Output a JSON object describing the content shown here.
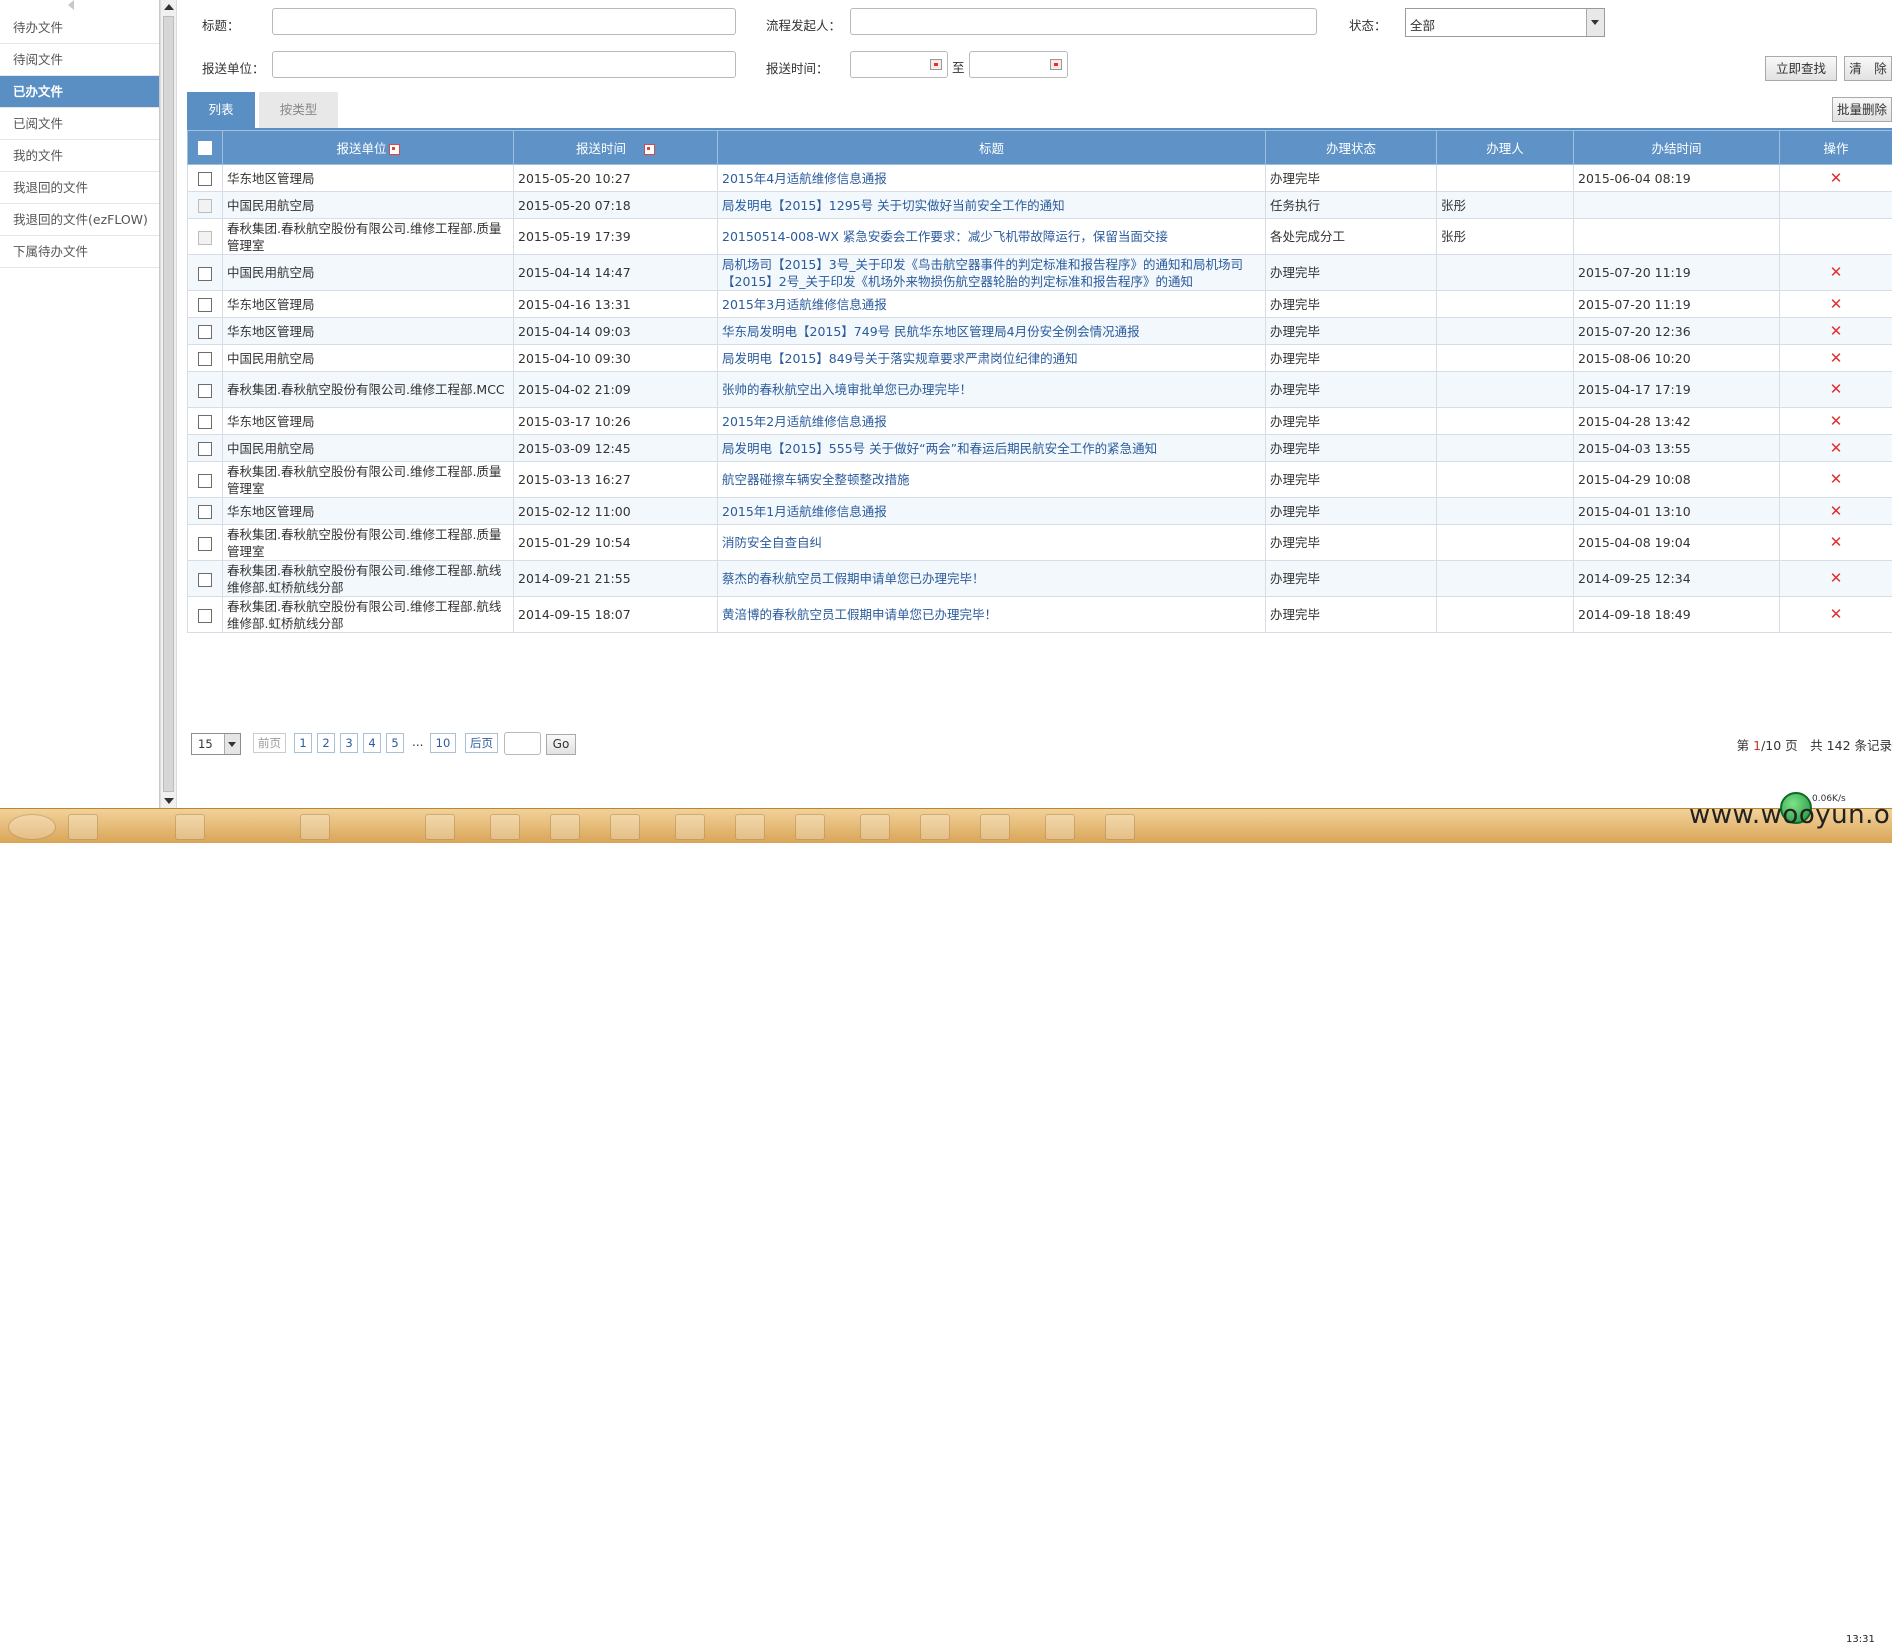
{
  "sidebar": {
    "items": [
      {
        "label": "待办文件",
        "active": false
      },
      {
        "label": "待阅文件",
        "active": false
      },
      {
        "label": "已办文件",
        "active": true
      },
      {
        "label": "已阅文件",
        "active": false
      },
      {
        "label": "我的文件",
        "active": false
      },
      {
        "label": "我退回的文件",
        "active": false
      },
      {
        "label": "我退回的文件(ezFLOW)",
        "active": false
      },
      {
        "label": "下属待办文件",
        "active": false
      }
    ]
  },
  "filters": {
    "title_label": "标题：",
    "title_value": "",
    "initiator_label": "流程发起人：",
    "initiator_value": "",
    "status_label": "状态：",
    "status_value": "全部",
    "unit_label": "报送单位：",
    "unit_value": "",
    "time_label": "报送时间：",
    "time_from": "",
    "time_to_label": "至",
    "time_to": "",
    "search_button": "立即查找",
    "clear_button": "清　除"
  },
  "tabs": {
    "list": "列表",
    "by_type": "按类型"
  },
  "batch_delete": "批量删除",
  "table": {
    "headers": {
      "unit": "报送单位",
      "time": "报送时间",
      "title": "标题",
      "status": "办理状态",
      "handler": "办理人",
      "done_time": "办结时间",
      "action": "操作"
    },
    "rows": [
      {
        "unit": "华东地区管理局",
        "time": "2015-05-20 10:27",
        "title": "2015年4月适航维修信息通报",
        "status": "办理完毕",
        "handler": "",
        "done_time": "2015-06-04 08:19",
        "deletable": true,
        "checkbox_enabled": true
      },
      {
        "unit": "中国民用航空局",
        "time": "2015-05-20 07:18",
        "title": "局发明电【2015】1295号 关于切实做好当前安全工作的通知",
        "status": "任务执行",
        "handler": "张彤",
        "done_time": "",
        "deletable": false,
        "checkbox_enabled": false
      },
      {
        "unit": "春秋集团.春秋航空股份有限公司.维修工程部.质量管理室",
        "time": "2015-05-19 17:39",
        "title": "20150514-008-WX 紧急安委会工作要求：减少飞机带故障运行，保留当面交接",
        "status": "各处完成分工",
        "handler": "张彤",
        "done_time": "",
        "deletable": false,
        "checkbox_enabled": false
      },
      {
        "unit": "中国民用航空局",
        "time": "2015-04-14 14:47",
        "title": "局机场司【2015】3号_关于印发《鸟击航空器事件的判定标准和报告程序》的通知和局机场司【2015】2号_关于印发《机场外来物损伤航空器轮胎的判定标准和报告程序》的通知",
        "status": "办理完毕",
        "handler": "",
        "done_time": "2015-07-20 11:19",
        "deletable": true,
        "checkbox_enabled": true
      },
      {
        "unit": "华东地区管理局",
        "time": "2015-04-16 13:31",
        "title": "2015年3月适航维修信息通报",
        "status": "办理完毕",
        "handler": "",
        "done_time": "2015-07-20 11:19",
        "deletable": true,
        "checkbox_enabled": true
      },
      {
        "unit": "华东地区管理局",
        "time": "2015-04-14 09:03",
        "title": "华东局发明电【2015】749号 民航华东地区管理局4月份安全例会情况通报",
        "status": "办理完毕",
        "handler": "",
        "done_time": "2015-07-20 12:36",
        "deletable": true,
        "checkbox_enabled": true
      },
      {
        "unit": "中国民用航空局",
        "time": "2015-04-10 09:30",
        "title": "局发明电【2015】849号关于落实规章要求严肃岗位纪律的通知",
        "status": "办理完毕",
        "handler": "",
        "done_time": "2015-08-06 10:20",
        "deletable": true,
        "checkbox_enabled": true
      },
      {
        "unit": "春秋集团.春秋航空股份有限公司.维修工程部.MCC",
        "time": "2015-04-02 21:09",
        "title": "张帅的春秋航空出入境审批单您已办理完毕！",
        "status": "办理完毕",
        "handler": "",
        "done_time": "2015-04-17 17:19",
        "deletable": true,
        "checkbox_enabled": true
      },
      {
        "unit": "华东地区管理局",
        "time": "2015-03-17 10:26",
        "title": "2015年2月适航维修信息通报",
        "status": "办理完毕",
        "handler": "",
        "done_time": "2015-04-28 13:42",
        "deletable": true,
        "checkbox_enabled": true
      },
      {
        "unit": "中国民用航空局",
        "time": "2015-03-09 12:45",
        "title": "局发明电【2015】555号 关于做好“两会”和春运后期民航安全工作的紧急通知",
        "status": "办理完毕",
        "handler": "",
        "done_time": "2015-04-03 13:55",
        "deletable": true,
        "checkbox_enabled": true
      },
      {
        "unit": "春秋集团.春秋航空股份有限公司.维修工程部.质量管理室",
        "time": "2015-03-13 16:27",
        "title": "航空器碰擦车辆安全整顿整改措施",
        "status": "办理完毕",
        "handler": "",
        "done_time": "2015-04-29 10:08",
        "deletable": true,
        "checkbox_enabled": true
      },
      {
        "unit": "华东地区管理局",
        "time": "2015-02-12 11:00",
        "title": "2015年1月适航维修信息通报",
        "status": "办理完毕",
        "handler": "",
        "done_time": "2015-04-01 13:10",
        "deletable": true,
        "checkbox_enabled": true
      },
      {
        "unit": "春秋集团.春秋航空股份有限公司.维修工程部.质量管理室",
        "time": "2015-01-29 10:54",
        "title": "消防安全自查自纠",
        "status": "办理完毕",
        "handler": "",
        "done_time": "2015-04-08 19:04",
        "deletable": true,
        "checkbox_enabled": true
      },
      {
        "unit": "春秋集团.春秋航空股份有限公司.维修工程部.航线维修部.虹桥航线分部",
        "time": "2014-09-21 21:55",
        "title": "蔡杰的春秋航空员工假期申请单您已办理完毕！",
        "status": "办理完毕",
        "handler": "",
        "done_time": "2014-09-25 12:34",
        "deletable": true,
        "checkbox_enabled": true
      },
      {
        "unit": "春秋集团.春秋航空股份有限公司.维修工程部.航线维修部.虹桥航线分部",
        "time": "2014-09-15 18:07",
        "title": "黄涪博的春秋航空员工假期申请单您已办理完毕！",
        "status": "办理完毕",
        "handler": "",
        "done_time": "2014-09-18 18:49",
        "deletable": true,
        "checkbox_enabled": true
      }
    ]
  },
  "pager": {
    "page_size": "15",
    "prev": "前页",
    "pages": [
      "1",
      "2",
      "3",
      "4",
      "5"
    ],
    "ellipsis": "...",
    "last_page": "10",
    "next": "后页",
    "goto_value": "",
    "go": "Go",
    "summary_prefix": "第 ",
    "current_page": "1",
    "summary_mid": "/10 页　共 142 条记录"
  },
  "taskbar": {
    "net_speed": "0.06K/s",
    "clock": "13:31"
  },
  "watermark": "www.wooyun.org",
  "colors": {
    "accent": "#5a8fc4",
    "header_bg": "#5f93c7",
    "link": "#2a5b9c",
    "delete": "#e03030",
    "taskbar": "#e0b46a"
  }
}
